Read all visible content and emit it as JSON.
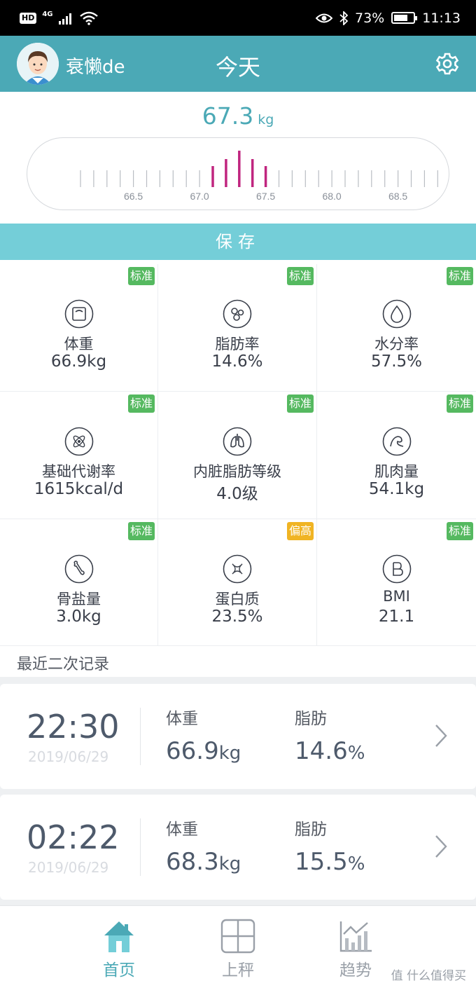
{
  "status_bar": {
    "left": [
      "HD",
      "4G"
    ],
    "battery": "73%",
    "battery_level": 0.73,
    "time": "11:13"
  },
  "header": {
    "user_name": "衰懒de",
    "title": "今天",
    "avatar_icon": "avatar-icon",
    "settings_icon": "gear-icon"
  },
  "weight": {
    "value": "67.3",
    "unit": "kg",
    "ruler_labels": [
      "66.5",
      "67.0",
      "67.5",
      "68.0",
      "68.5"
    ],
    "selected": 67.3,
    "accent": "#c0257f"
  },
  "save_label": "保存",
  "metrics": [
    {
      "label": "体重",
      "value": "66.9kg",
      "status": "标准",
      "icon": "scale-icon"
    },
    {
      "label": "脂肪率",
      "value": "14.6%",
      "status": "标准",
      "icon": "fat-cells-icon"
    },
    {
      "label": "水分率",
      "value": "57.5%",
      "status": "标准",
      "icon": "water-drop-icon"
    },
    {
      "label": "基础代谢率",
      "value": "1615kcal/d",
      "status": "标准",
      "icon": "atom-icon"
    },
    {
      "label": "内脏脂肪等级",
      "value": "4.0级",
      "status": "标准",
      "icon": "lungs-icon"
    },
    {
      "label": "肌肉量",
      "value": "54.1kg",
      "status": "标准",
      "icon": "muscle-arm-icon"
    },
    {
      "label": "骨盐量",
      "value": "3.0kg",
      "status": "标准",
      "icon": "bone-icon"
    },
    {
      "label": "蛋白质",
      "value": "23.5%",
      "status": "偏高",
      "icon": "protein-icon"
    },
    {
      "label": "BMI",
      "value": "21.1",
      "status": "标准",
      "icon": "bmi-icon"
    }
  ],
  "colors": {
    "primary": "#4ba9b6",
    "save": "#74ced8",
    "badge_normal": "#55b960",
    "badge_high": "#f0b423"
  },
  "recent": {
    "title": "最近二次记录",
    "weight_label": "体重",
    "fat_label": "脂肪",
    "records": [
      {
        "time": "22:30",
        "date": "2019/06/29",
        "weight": "66.9",
        "weight_unit": "kg",
        "fat": "14.6",
        "fat_unit": "%"
      },
      {
        "time": "02:22",
        "date": "2019/06/29",
        "weight": "68.3",
        "weight_unit": "kg",
        "fat": "15.5",
        "fat_unit": "%"
      }
    ]
  },
  "nav": {
    "items": [
      {
        "label": "首页",
        "icon": "home-icon",
        "active": true
      },
      {
        "label": "上秤",
        "icon": "scale-grid-icon",
        "active": false
      },
      {
        "label": "趋势",
        "icon": "trend-chart-icon",
        "active": false
      }
    ]
  },
  "watermark": "值 什么值得买"
}
